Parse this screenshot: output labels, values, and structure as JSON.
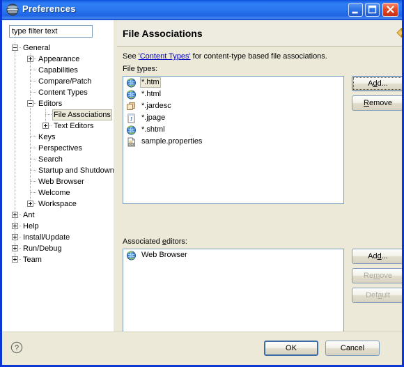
{
  "window": {
    "title": "Preferences",
    "icon": "eclipse-sphere-icon",
    "minimize_label": "",
    "maximize_label": "",
    "close_label": ""
  },
  "filter": {
    "value": "type filter text",
    "placeholder": "type filter text"
  },
  "tree": {
    "items": [
      {
        "label": "General",
        "level": 0,
        "expander": "minus",
        "selected": false
      },
      {
        "label": "Appearance",
        "level": 1,
        "expander": "plus",
        "selected": false
      },
      {
        "label": "Capabilities",
        "level": 1,
        "expander": "none",
        "selected": false
      },
      {
        "label": "Compare/Patch",
        "level": 1,
        "expander": "none",
        "selected": false
      },
      {
        "label": "Content Types",
        "level": 1,
        "expander": "none",
        "selected": false
      },
      {
        "label": "Editors",
        "level": 1,
        "expander": "minus",
        "selected": false
      },
      {
        "label": "File Associations",
        "level": 2,
        "expander": "none",
        "selected": true
      },
      {
        "label": "Text Editors",
        "level": 2,
        "expander": "plus",
        "selected": false
      },
      {
        "label": "Keys",
        "level": 1,
        "expander": "none",
        "selected": false
      },
      {
        "label": "Perspectives",
        "level": 1,
        "expander": "none",
        "selected": false
      },
      {
        "label": "Search",
        "level": 1,
        "expander": "none",
        "selected": false
      },
      {
        "label": "Startup and Shutdown",
        "level": 1,
        "expander": "none",
        "selected": false
      },
      {
        "label": "Web Browser",
        "level": 1,
        "expander": "none",
        "selected": false
      },
      {
        "label": "Welcome",
        "level": 1,
        "expander": "none",
        "selected": false
      },
      {
        "label": "Workspace",
        "level": 1,
        "expander": "plus",
        "selected": false
      },
      {
        "label": "Ant",
        "level": 0,
        "expander": "plus",
        "selected": false
      },
      {
        "label": "Help",
        "level": 0,
        "expander": "plus",
        "selected": false
      },
      {
        "label": "Install/Update",
        "level": 0,
        "expander": "plus",
        "selected": false
      },
      {
        "label": "Run/Debug",
        "level": 0,
        "expander": "plus",
        "selected": false
      },
      {
        "label": "Team",
        "level": 0,
        "expander": "plus",
        "selected": false
      }
    ]
  },
  "page": {
    "title": "File Associations",
    "nav_back": "back-arrow-icon",
    "nav_forward": "forward-arrow-icon",
    "description_prefix": "See ",
    "description_link": "'Content Types'",
    "description_suffix": " for content-type based file associations.",
    "file_types_label_pre": "File ",
    "file_types_label_mnemonic": "t",
    "file_types_label_post": "ypes:",
    "associated_editors_label_pre": "Associated ",
    "associated_editors_label_mnemonic": "e",
    "associated_editors_label_post": "ditors:"
  },
  "file_types": {
    "items": [
      {
        "label": "*.htm",
        "icon": "web-globe-icon",
        "selected": true
      },
      {
        "label": "*.html",
        "icon": "web-globe-icon",
        "selected": false
      },
      {
        "label": "*.jardesc",
        "icon": "jar-archive-icon",
        "selected": false
      },
      {
        "label": "*.jpage",
        "icon": "java-page-icon",
        "selected": false
      },
      {
        "label": "*.shtml",
        "icon": "web-globe-icon",
        "selected": false
      },
      {
        "label": "sample.properties",
        "icon": "properties-file-icon",
        "selected": false
      }
    ]
  },
  "associated_editors": {
    "items": [
      {
        "label": "Web Browser",
        "icon": "web-globe-icon",
        "selected": false
      }
    ]
  },
  "buttons": {
    "add_file_type": {
      "label": "Add...",
      "mnemonic_index": 1,
      "enabled": true,
      "focused": true
    },
    "remove_file_type": {
      "label": "Remove",
      "mnemonic_index": 0,
      "enabled": true,
      "focused": false
    },
    "add_editor": {
      "label": "Add...",
      "mnemonic_index": 2,
      "enabled": true,
      "focused": false
    },
    "remove_editor": {
      "label": "Remove",
      "mnemonic_index": 2,
      "enabled": false,
      "focused": false
    },
    "default_editor": {
      "label": "Default",
      "mnemonic_index": 3,
      "enabled": false,
      "focused": false
    },
    "ok": {
      "label": "OK",
      "enabled": true,
      "is_default": true
    },
    "cancel": {
      "label": "Cancel",
      "enabled": true,
      "is_default": false
    }
  },
  "help": {
    "icon": "help-question-icon"
  },
  "colors": {
    "title_bar_blue": "#2a78f0",
    "window_border": "#0a36d4",
    "dialog_background": "#ece9d8",
    "list_background": "#ffffff",
    "selection_inactive": "#ece9d8",
    "link_blue": "#0000c0",
    "close_button_red": "#e5502a",
    "nav_back_gold": "#e8a33d",
    "nav_forward_grey": "#c8c8c0"
  }
}
